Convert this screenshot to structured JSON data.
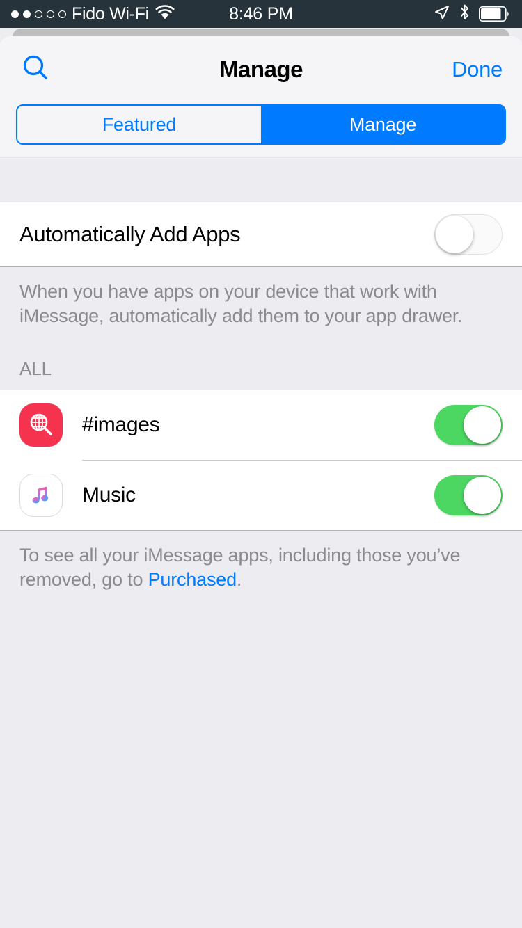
{
  "statusbar": {
    "signal_dots_filled": 2,
    "signal_dots_total": 5,
    "carrier": "Fido Wi-Fi",
    "wifi_icon": "wifi-icon",
    "time": "8:46 PM",
    "location_icon": "location-arrow-icon",
    "bluetooth_icon": "bluetooth-icon",
    "battery_icon": "battery-icon",
    "battery_level_percent": 80,
    "background_color": "#26333A"
  },
  "navbar": {
    "search_icon": "search-icon",
    "title": "Manage",
    "done_label": "Done",
    "accent_color": "#007AFF"
  },
  "segmented_control": {
    "options": [
      {
        "label": "Featured",
        "selected": false
      },
      {
        "label": "Manage",
        "selected": true
      }
    ]
  },
  "settings": {
    "auto_add": {
      "label": "Automatically Add Apps",
      "enabled": false
    },
    "auto_add_footer": "When you have apps on your device that work with iMessage, automatically add them to your app drawer."
  },
  "all_section": {
    "header": "ALL",
    "apps": [
      {
        "icon": "images-app-icon",
        "name": "#images",
        "enabled": true,
        "icon_color": "#F5334F"
      },
      {
        "icon": "music-app-icon",
        "name": "Music",
        "enabled": true,
        "icon_color": "#FFFFFF"
      }
    ],
    "footer_prefix": "To see all your iMessage apps, including those you’ve removed, go to ",
    "footer_link": "Purchased",
    "footer_suffix": "."
  },
  "colors": {
    "toggle_on": "#4CD662",
    "accent": "#007AFF",
    "background": "#ECECF1"
  }
}
